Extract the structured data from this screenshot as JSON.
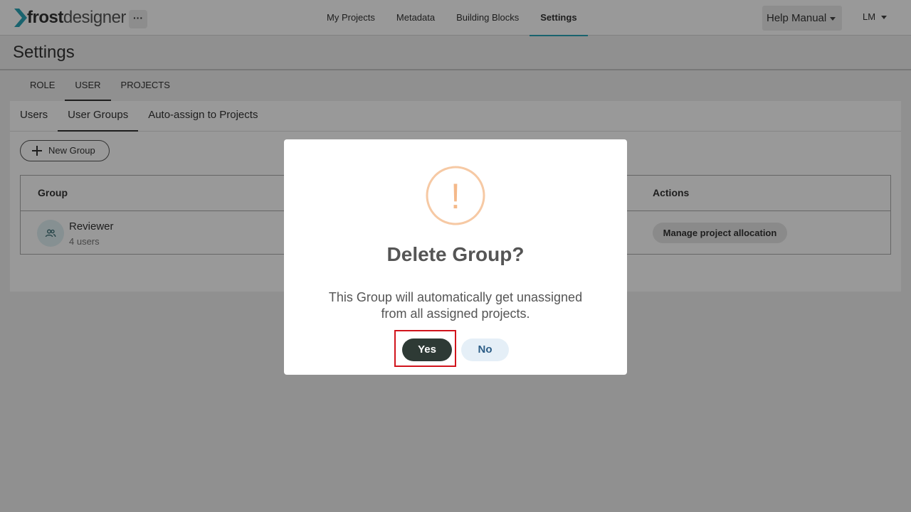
{
  "app": {
    "logo_bold": "frost",
    "logo_light": "designer",
    "more_label": "···"
  },
  "nav": {
    "items": [
      {
        "label": "My Projects"
      },
      {
        "label": "Metadata"
      },
      {
        "label": "Building Blocks"
      },
      {
        "label": "Settings"
      }
    ],
    "active": "Settings",
    "help_label": "Help Manual",
    "user_initials": "LM"
  },
  "page": {
    "title": "Settings"
  },
  "tabs_primary": {
    "items": [
      {
        "label": "ROLE"
      },
      {
        "label": "USER"
      },
      {
        "label": "PROJECTS"
      }
    ],
    "active": "USER"
  },
  "tabs_secondary": {
    "items": [
      {
        "label": "Users"
      },
      {
        "label": "User Groups"
      },
      {
        "label": "Auto-assign to Projects"
      }
    ],
    "active": "User Groups"
  },
  "new_group_label": "New Group",
  "table": {
    "headers": {
      "group": "Group",
      "actions": "Actions"
    },
    "rows": [
      {
        "name": "Reviewer",
        "count": "4 users",
        "action": "Manage project allocation"
      }
    ]
  },
  "dialog": {
    "icon": "exclamation-icon",
    "icon_char": "!",
    "title": "Delete Group?",
    "message": "This Group will automatically get unassigned from all assigned projects.",
    "yes_label": "Yes",
    "no_label": "No"
  },
  "colors": {
    "accent": "#2aa6b7",
    "warning": "#f6c9a4",
    "yes_bg": "#2e3a35",
    "no_bg": "#e5eff7",
    "highlight": "#d1141c"
  }
}
